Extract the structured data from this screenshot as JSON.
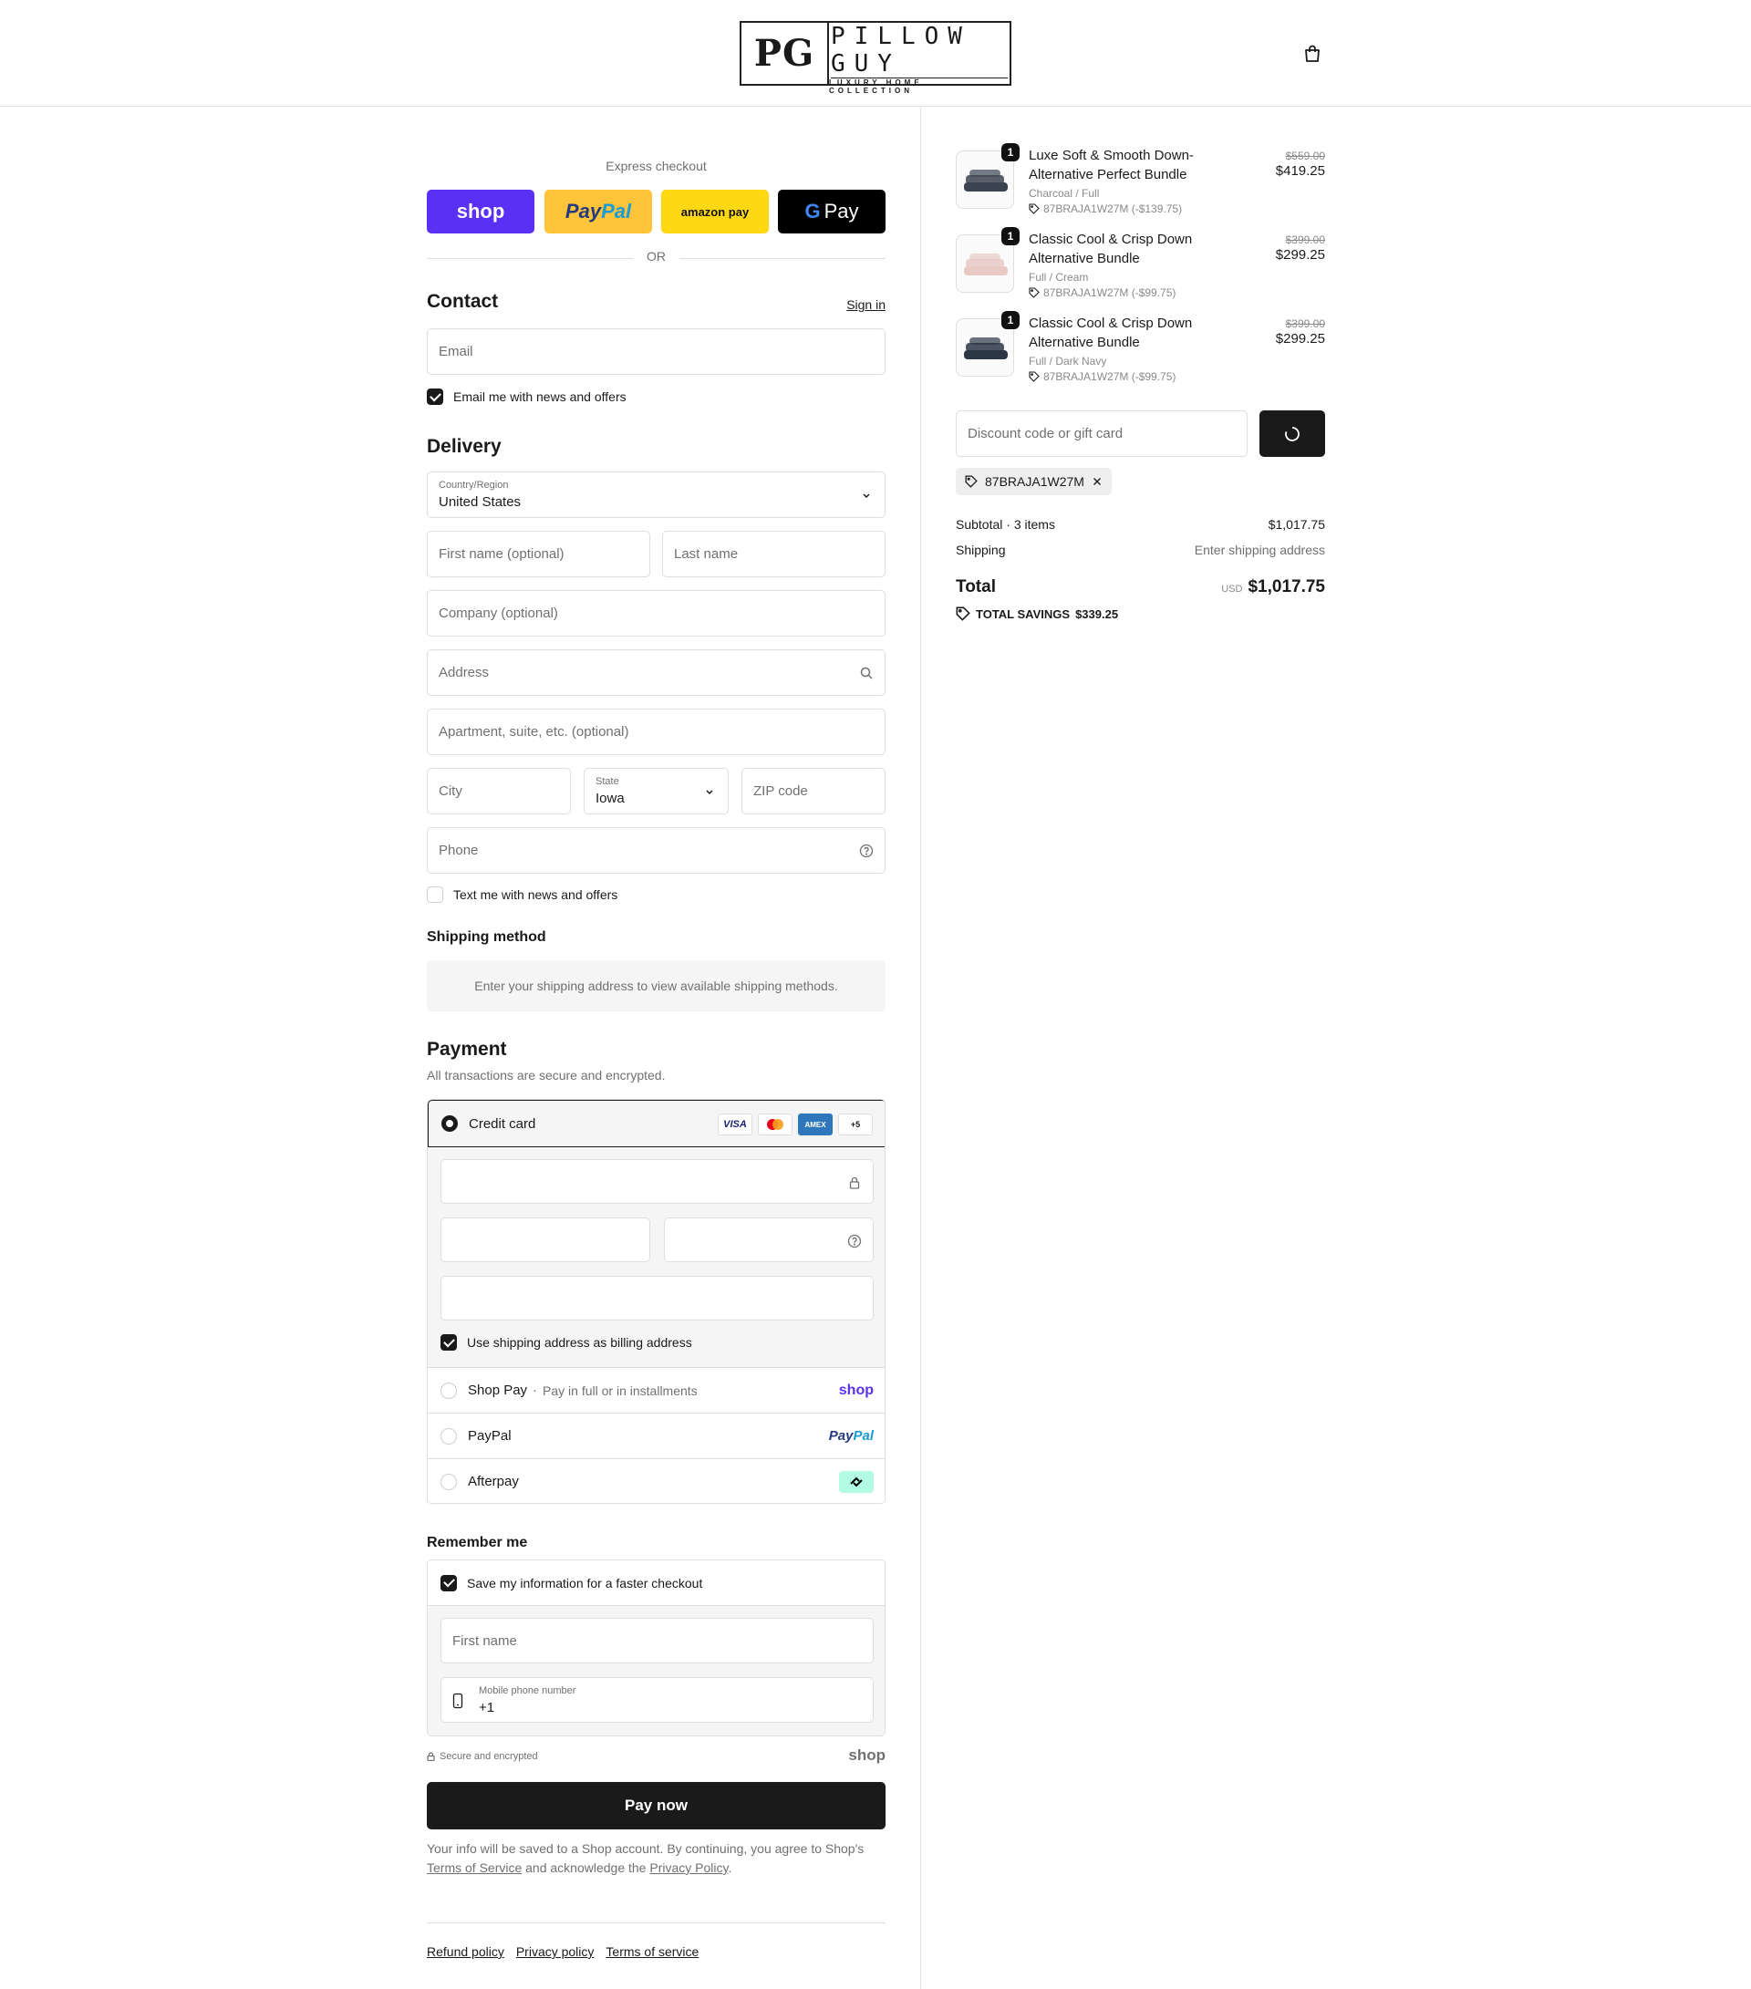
{
  "header": {
    "logo_initials": "PG",
    "logo_name": "PILLOW GUY",
    "logo_tagline": "LUXURY HOME COLLECTION",
    "cart_icon": "shopping-bag-icon"
  },
  "express": {
    "title": "Express checkout",
    "shop_label": "shop",
    "paypal_label_1": "Pay",
    "paypal_label_2": "Pal",
    "amazon_label": "amazon pay",
    "gpay_g": "G",
    "gpay_label": "Pay",
    "or_label": "OR"
  },
  "contact": {
    "title": "Contact",
    "sign_in": "Sign in",
    "email_placeholder": "Email",
    "news_label": "Email me with news and offers",
    "news_checked": true
  },
  "delivery": {
    "title": "Delivery",
    "country_label": "Country/Region",
    "country_value": "United States",
    "first_name_placeholder": "First name (optional)",
    "last_name_placeholder": "Last name",
    "company_placeholder": "Company (optional)",
    "address_placeholder": "Address",
    "apartment_placeholder": "Apartment, suite, etc. (optional)",
    "city_placeholder": "City",
    "state_label": "State",
    "state_value": "Iowa",
    "zip_placeholder": "ZIP code",
    "phone_placeholder": "Phone",
    "text_label": "Text me with news and offers",
    "text_checked": false
  },
  "shipping_method": {
    "title": "Shipping method",
    "note": "Enter your shipping address to view available shipping methods."
  },
  "payment": {
    "title": "Payment",
    "subtitle": "All transactions are secure and encrypted.",
    "credit_card_label": "Credit card",
    "card_visa": "VISA",
    "card_amex": "AMEX",
    "card_more": "+5",
    "billing_label": "Use shipping address as billing address",
    "billing_checked": true,
    "shop_pay_label": "Shop Pay",
    "shop_pay_sub": "Pay in full or in installments",
    "shop_pay_logo": "shop",
    "paypal_label": "PayPal",
    "paypal_logo_1": "Pay",
    "paypal_logo_2": "Pal",
    "afterpay_label": "Afterpay"
  },
  "remember": {
    "title": "Remember me",
    "save_label": "Save my information for a faster checkout",
    "save_checked": true,
    "first_name_placeholder": "First name",
    "mobile_label": "Mobile phone number",
    "mobile_value": "+1",
    "secure_label": "Secure and encrypted",
    "shop_logo": "shop"
  },
  "pay_now": "Pay now",
  "legal": {
    "part1": "Your info will be saved to a Shop account. By continuing, you agree to Shop's ",
    "terms": "Terms of Service",
    "part2": " and acknowledge the ",
    "privacy": "Privacy Policy",
    "part3": "."
  },
  "footer": {
    "links": [
      "Refund policy",
      "Privacy policy",
      "Terms of service"
    ]
  },
  "cart": {
    "items": [
      {
        "qty": "1",
        "name": "Luxe Soft & Smooth Down-Alternative Perfect Bundle",
        "variant": "Charcoal / Full",
        "discount": "87BRAJA1W27M (-$139.75)",
        "old_price": "$559.00",
        "price": "$419.25",
        "color": "#3b4350"
      },
      {
        "qty": "1",
        "name": "Classic Cool & Crisp Down Alternative Bundle",
        "variant": "Full / Cream",
        "discount": "87BRAJA1W27M (-$99.75)",
        "old_price": "$399.00",
        "price": "$299.25",
        "color": "#e8c9c4"
      },
      {
        "qty": "1",
        "name": "Classic Cool & Crisp Down Alternative Bundle",
        "variant": "Full / Dark Navy",
        "discount": "87BRAJA1W27M (-$99.75)",
        "old_price": "$399.00",
        "price": "$299.25",
        "color": "#2c3644"
      }
    ],
    "discount_placeholder": "Discount code or gift card",
    "applied_code": "87BRAJA1W27M",
    "subtotal_label": "Subtotal · 3 items",
    "subtotal_value": "$1,017.75",
    "shipping_label": "Shipping",
    "shipping_value": "Enter shipping address",
    "total_label": "Total",
    "currency": "USD",
    "total_value": "$1,017.75",
    "savings_label": "TOTAL SAVINGS",
    "savings_value": "$339.25"
  },
  "colors": {
    "shop_purple": "#5a31f4",
    "paypal_yellow": "#ffc439",
    "amazon_yellow": "#ffd814",
    "dark": "#1a1a1a",
    "afterpay_mint": "#b2fce4"
  }
}
